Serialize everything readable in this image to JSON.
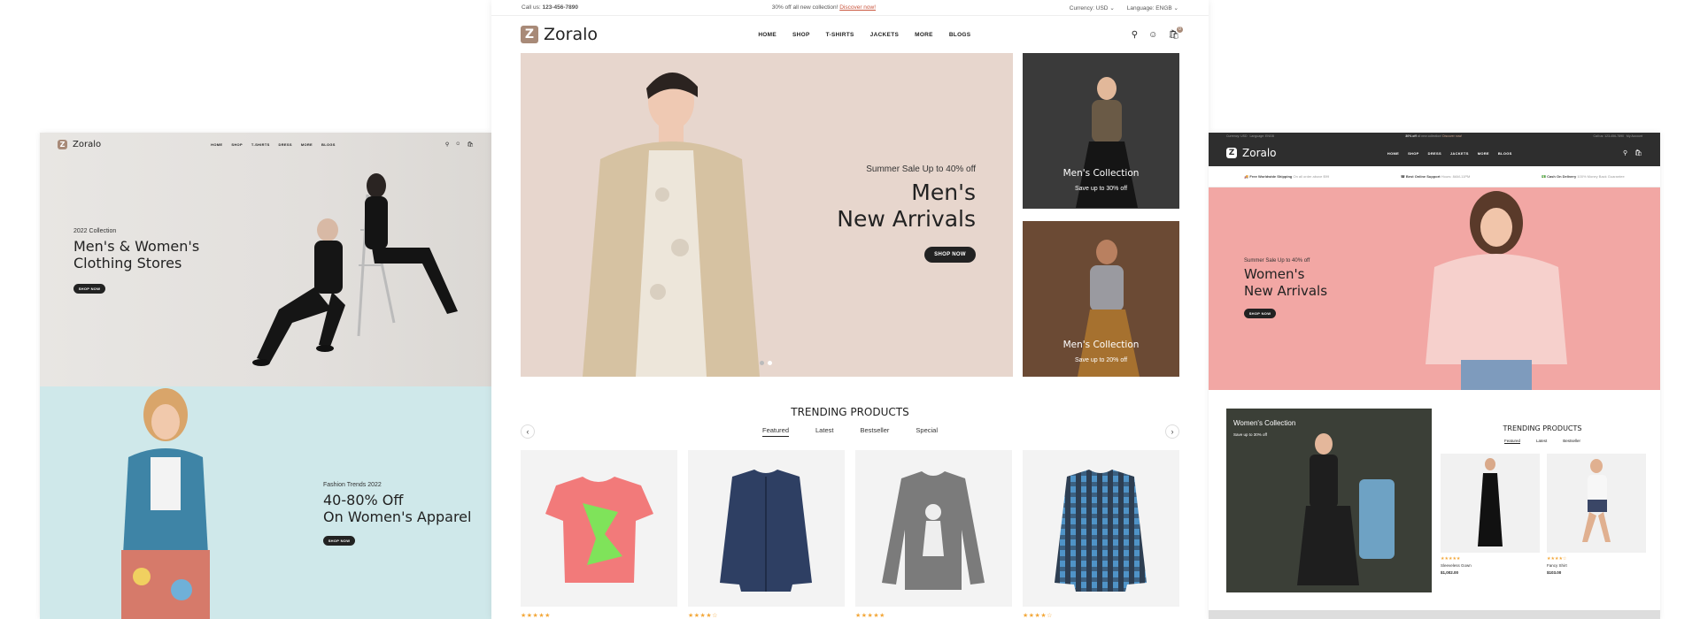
{
  "brand": {
    "name": "Zoralo",
    "mark": "Z",
    "accent": "#a88a78"
  },
  "center": {
    "topbar": {
      "call_label": "Call us:",
      "call_number": "123-456-7890",
      "promo": "30% off all new collection!",
      "promo_link": "Discover now!",
      "currency": "Currency: USD",
      "language": "Language: ENGB"
    },
    "nav": [
      "HOME",
      "SHOP",
      "T-SHIRTS",
      "JACKETS",
      "MORE",
      "BLOGS"
    ],
    "cart_count": "0",
    "hero": {
      "kicker": "Summer Sale Up to 40% off",
      "title_line1": "Men's",
      "title_line2": "New Arrivals",
      "cta": "SHOP NOW"
    },
    "side_cards": [
      {
        "title": "Men's Collection",
        "sub": "Save up to 30% off"
      },
      {
        "title": "Men's Collection",
        "sub": "Save up to 20% off"
      }
    ],
    "trending": {
      "title": "TRENDING PRODUCTS",
      "tabs": [
        "Featured",
        "Latest",
        "Bestseller",
        "Special"
      ],
      "ratings": [
        5,
        4,
        5,
        4
      ]
    }
  },
  "left": {
    "nav": [
      "HOME",
      "SHOP",
      "T-SHIRTS",
      "DRESS",
      "MORE",
      "BLOGS"
    ],
    "hero1": {
      "kicker": "2022 Collection",
      "line1": "Men's & Women's",
      "line2": "Clothing Stores",
      "cta": "SHOP NOW"
    },
    "hero2": {
      "kicker": "Fashion Trends 2022",
      "line1": "40-80% Off",
      "line2": "On Women's Apparel",
      "cta": "SHOP NOW"
    }
  },
  "right": {
    "topbar": {
      "left": "Currency: USD",
      "left2": "Language: ENGB",
      "promo": "30% off",
      "promo_rest": "all new collection!",
      "link": "Discover now!",
      "right": "Call us: 123-456-7890",
      "right2": "My Account"
    },
    "nav": [
      "HOME",
      "SHOP",
      "DRESS",
      "JACKETS",
      "MORE",
      "BLOGS"
    ],
    "features": [
      {
        "title": "Free Worldwide Shipping",
        "desc": "On all order above $99"
      },
      {
        "title": "Best Online Support",
        "desc": "Hours: 8AM-11PM"
      },
      {
        "title": "Cash On Delivery",
        "desc": "100% Money Back Guarantee"
      }
    ],
    "hero": {
      "kicker": "Summer Sale Up to 40% off",
      "line1": "Women's",
      "line2": "New Arrivals",
      "cta": "SHOP NOW"
    },
    "collection": {
      "title": "Women's Collection",
      "sub": "Save up to 30% off"
    },
    "trending": {
      "title": "TRENDING PRODUCTS",
      "tabs": [
        "Featured",
        "Latest",
        "Bestseller"
      ]
    },
    "products": [
      {
        "name": "Sleeveless Gown",
        "price": "$1,002.00"
      },
      {
        "name": "Fancy Shirt",
        "price": "$103.00"
      }
    ]
  }
}
